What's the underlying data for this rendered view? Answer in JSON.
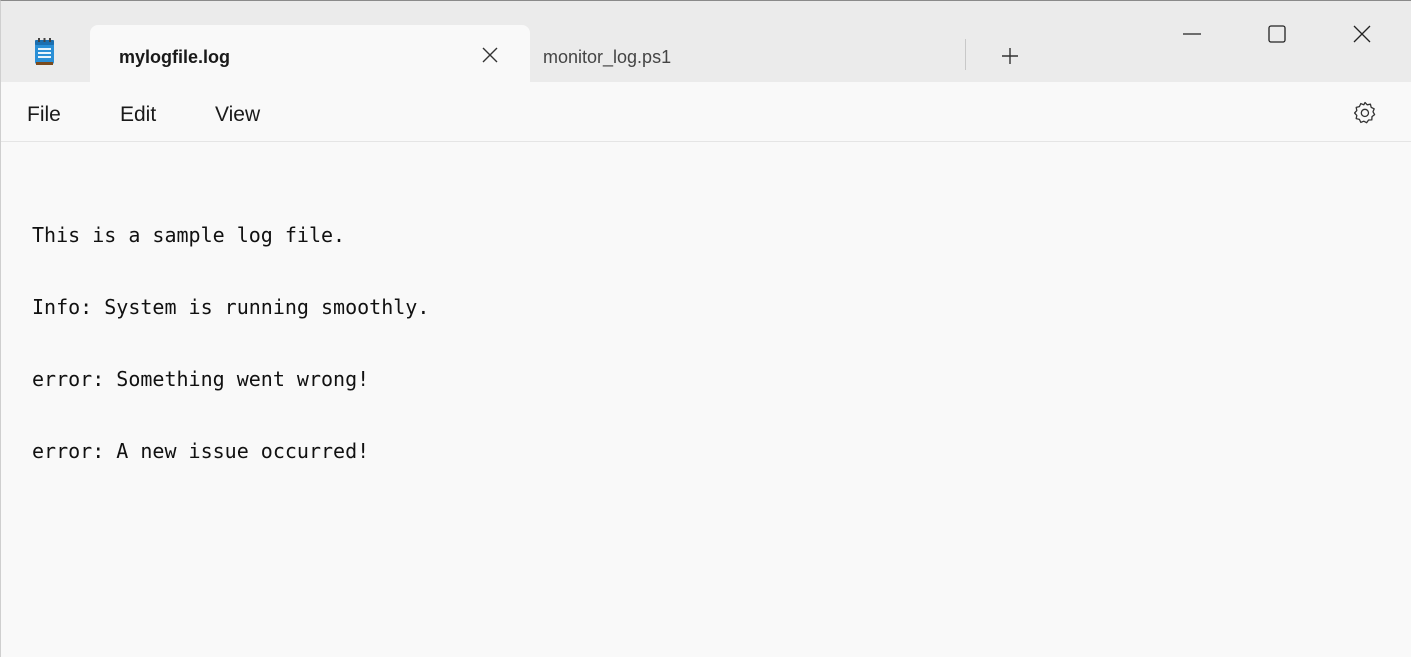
{
  "window": {
    "tabs": [
      {
        "label": "mylogfile.log",
        "active": true
      },
      {
        "label": "monitor_log.ps1",
        "active": false
      }
    ],
    "icons": {
      "app": "notepad-icon",
      "tab_close": "close-icon",
      "new_tab": "plus-icon",
      "minimize": "minimize-icon",
      "maximize": "maximize-icon",
      "close": "close-icon",
      "settings": "gear-icon"
    }
  },
  "menu": {
    "file": "File",
    "edit": "Edit",
    "view": "View"
  },
  "editor": {
    "lines": [
      "This is a sample log file.",
      "Info: System is running smoothly.",
      "error: Something went wrong!",
      "error: A new issue occurred!"
    ]
  },
  "colors": {
    "titlebar": "#ebebeb",
    "background": "#f9f9f9",
    "icon_accent": "#1e88c8"
  }
}
